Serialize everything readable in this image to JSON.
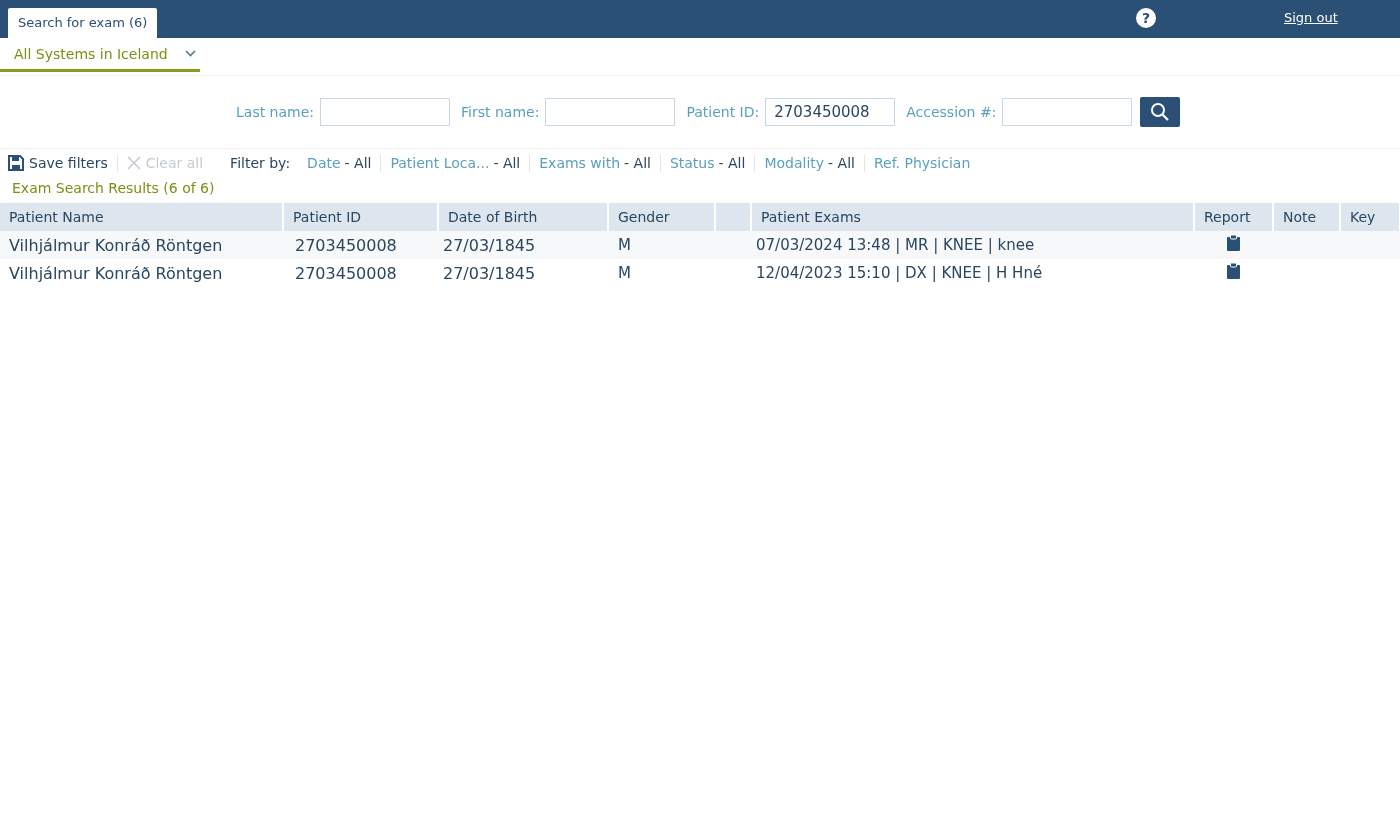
{
  "tabs": [
    {
      "label": "Search for exam (6)",
      "selected": true
    }
  ],
  "header": {
    "help": "?",
    "sign_out": "Sign out"
  },
  "system_selector": {
    "value": "All Systems in Iceland"
  },
  "search_fields": [
    {
      "label": "Last name:"
    },
    {
      "label": "First name:"
    },
    {
      "label": "Patient ID:",
      "value": "2703450008"
    },
    {
      "label": "Accession #:"
    }
  ],
  "toolbar": {
    "save_filters": "Save filters",
    "clear_all": "Clear all",
    "clear_all_disabled": true,
    "filter_by": "Filter by:"
  },
  "filters": [
    {
      "label": "Date",
      "value": "- All"
    },
    {
      "label": "Patient Loca...",
      "value": "- All"
    },
    {
      "label": "Exams with",
      "value": "- All"
    },
    {
      "label": "Status",
      "value": "- All"
    },
    {
      "label": "Modality",
      "value": "- All"
    },
    {
      "label": "Ref. Physician"
    }
  ],
  "results_title": "Exam Search Results (6 of 6)",
  "table": {
    "columns": [
      "Patient Name",
      "Patient ID",
      "Date of Birth",
      "Gender",
      null,
      "Patient Exams",
      "Report",
      "Note",
      "Key"
    ],
    "rows": [
      {
        "name": "Vilhjálmur Konráð Röntgen",
        "patient_id": "2703450008",
        "dob": "27/03/1845",
        "gender": "M",
        "exams": "07/03/2024 13:48 | MR | KNEE | knee",
        "report": true
      },
      {
        "name": "Vilhjálmur Konráð Röntgen",
        "patient_id": "2703450008",
        "dob": "27/03/1845",
        "gender": "M",
        "exams": "12/04/2023 15:10 | DX | KNEE | H Hné",
        "report": true
      }
    ]
  }
}
